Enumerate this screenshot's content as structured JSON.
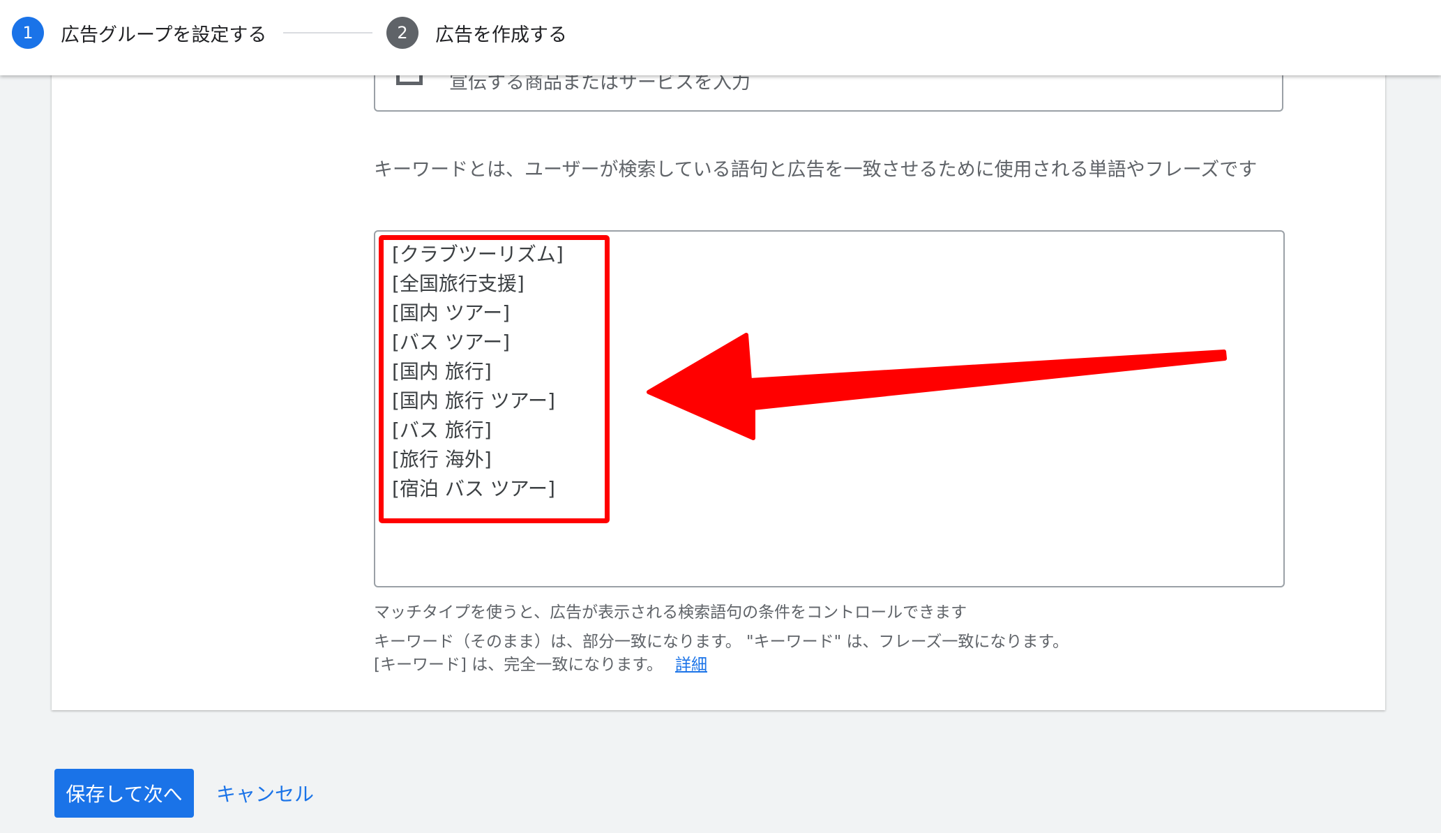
{
  "stepper": {
    "step1": {
      "number": "1",
      "label": "広告グループを設定する"
    },
    "step2": {
      "number": "2",
      "label": "広告を作成する"
    }
  },
  "product": {
    "placeholder": "宣伝する商品またはサービスを入力"
  },
  "keywords": {
    "help": "キーワードとは、ユーザーが検索している語句と広告を一致させるために使用される単語やフレーズです",
    "items": [
      "[クラブツーリズム]",
      "[全国旅行支援]",
      "[国内 ツアー]",
      "[バス ツアー]",
      "[国内 旅行]",
      "[国内 旅行 ツアー]",
      "[バス 旅行]",
      "[旅行 海外]",
      "[宿泊 バス ツアー]"
    ],
    "match_hint": "マッチタイプを使うと、広告が表示される検索語句の条件をコントロールできます",
    "match_line1": "キーワード（そのまま）は、部分一致になります。 \"キーワード\" は、フレーズ一致になります。",
    "match_line2": "[キーワード] は、完全一致になります。",
    "detail_link": "詳細"
  },
  "actions": {
    "save_label": "保存して次へ",
    "cancel_label": "キャンセル"
  },
  "colors": {
    "primary": "#1a73e8",
    "annotation": "#ff0000"
  }
}
